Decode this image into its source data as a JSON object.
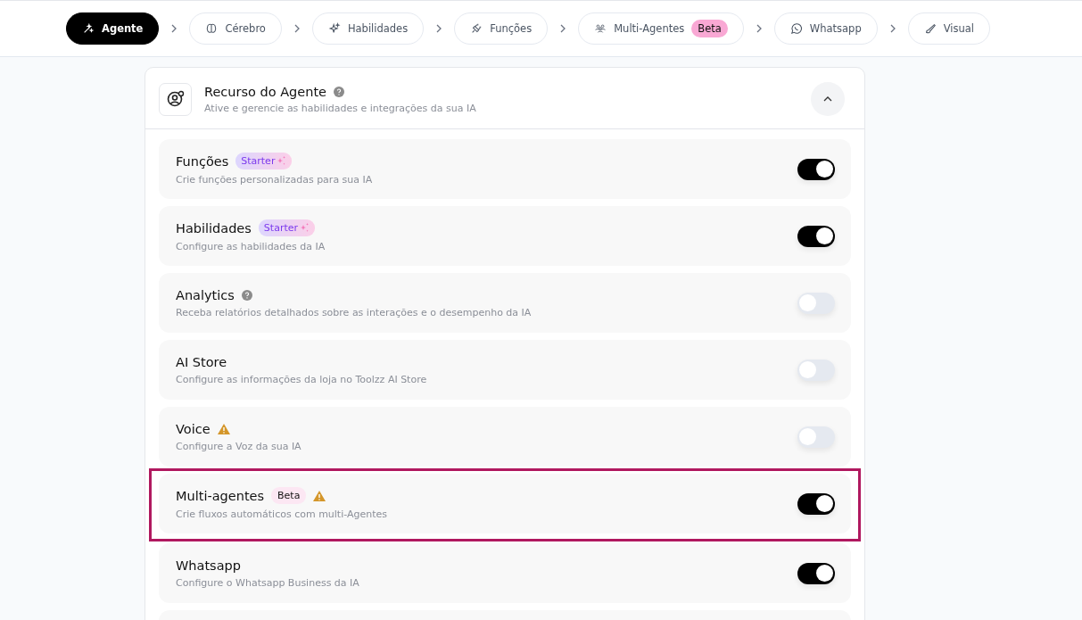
{
  "steps": [
    {
      "label": "Agente",
      "selected": true
    },
    {
      "label": "Cérebro",
      "selected": false
    },
    {
      "label": "Habilidades",
      "selected": false
    },
    {
      "label": "Funções",
      "selected": false
    },
    {
      "label": "Multi-Agentes",
      "badge": "Beta",
      "selected": false
    },
    {
      "label": "Whatsapp",
      "selected": false
    },
    {
      "label": "Visual",
      "selected": false
    }
  ],
  "panel": {
    "title": "Recurso do Agente",
    "subtitle": "Ative e gerencie as habilidades e integrações da sua IA",
    "expanded": true
  },
  "features": [
    {
      "name": "Funções",
      "badge": {
        "label": "Starter",
        "kind": "starter"
      },
      "description": "Crie funções personalizadas para sua IA",
      "on": true,
      "highlighted": false
    },
    {
      "name": "Habilidades",
      "badge": {
        "label": "Starter",
        "kind": "starter"
      },
      "description": "Configure as habilidades da IA",
      "on": true,
      "highlighted": false
    },
    {
      "name": "Analytics",
      "help": true,
      "description": "Receba relatórios detalhados sobre as interações e o desempenho da IA",
      "on": false,
      "highlighted": false
    },
    {
      "name": "AI Store",
      "description": "Configure as informações da loja no Toolzz AI Store",
      "on": false,
      "highlighted": false
    },
    {
      "name": "Voice",
      "warning": true,
      "description": "Configure a Voz da sua IA",
      "on": false,
      "highlighted": false
    },
    {
      "name": "Multi-agentes",
      "badge": {
        "label": "Beta",
        "kind": "beta"
      },
      "warning": true,
      "description": "Crie fluxos automáticos com multi-Agentes",
      "on": true,
      "highlighted": true
    },
    {
      "name": "Whatsapp",
      "description": "Configure o Whatsapp Business da IA",
      "on": true,
      "highlighted": false
    }
  ]
}
